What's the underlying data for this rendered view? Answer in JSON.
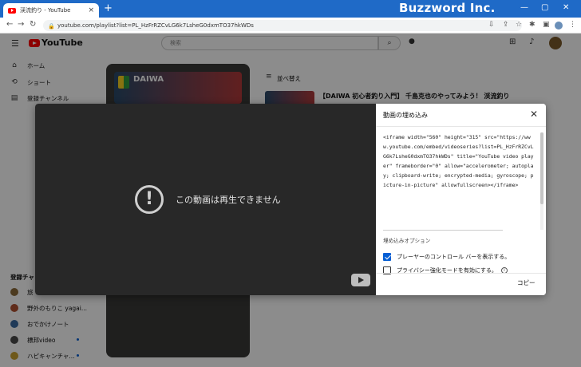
{
  "browser": {
    "tab_title": "渓流釣り - YouTube",
    "tab_close": "×",
    "new_tab": "+",
    "brand": "Buzzword Inc.",
    "win_min": "—",
    "win_max": "▢",
    "win_close": "✕",
    "url": "youtube.com/playlist?list=PL_HzFrRZCvLG6k7LsheG0dxmTO37hkWDs"
  },
  "youtube": {
    "logo_text": "YouTube",
    "search_placeholder": "検索",
    "sidebar": [
      {
        "icon": "home-icon",
        "glyph": "⌂",
        "label": "ホーム"
      },
      {
        "icon": "shorts-icon",
        "glyph": "⟲",
        "label": "ショート"
      },
      {
        "icon": "subscriptions-icon",
        "glyph": "▤",
        "label": "登録チャンネル"
      }
    ],
    "subscriptions_header": "登録チャ",
    "subscriptions": [
      {
        "label": "旅",
        "color": "#8a6a3a",
        "dot": false
      },
      {
        "label": "野外のもりこ yagai...",
        "color": "#b05030",
        "dot": false
      },
      {
        "label": "おでかけノート",
        "color": "#3a6aa0",
        "dot": false
      },
      {
        "label": "標邦video",
        "color": "#4a4a4a",
        "dot": true
      },
      {
        "label": "ハピキャンチャ...",
        "color": "#c8a030",
        "dot": true
      }
    ],
    "playlist_thumb_brand": "DAIWA",
    "sort_label": "並べ替え",
    "video_title": "【DAIWA 初心者釣り入門】 千島克也のやってみよう！ 渓流釣り"
  },
  "player": {
    "error_text": "この動画は再生できません"
  },
  "embed_panel": {
    "title": "動画の埋め込み",
    "close": "✕",
    "code": "<iframe width=\"560\" height=\"315\" src=\"https://www.youtube.com/embed/videoseries?list=PL_HzFrRZCvLG6k7LsheG0dxmTO37hkWDs\" title=\"YouTube video player\" frameborder=\"0\" allow=\"accelerometer; autoplay; clipboard-write; encrypted-media; gyroscope; picture-in-picture\" allowfullscreen></iframe>",
    "options_header": "埋め込みオプション",
    "options": [
      {
        "label": "プレーヤーのコントロール バーを表示する。",
        "checked": true
      },
      {
        "label": "プライバシー強化モードを有効にする。",
        "checked": false
      }
    ],
    "copy_label": "コピー"
  },
  "colors": {
    "accent_blue": "#065fd4",
    "titlebar_blue": "#1f6ac7",
    "player_bg": "#282828"
  }
}
